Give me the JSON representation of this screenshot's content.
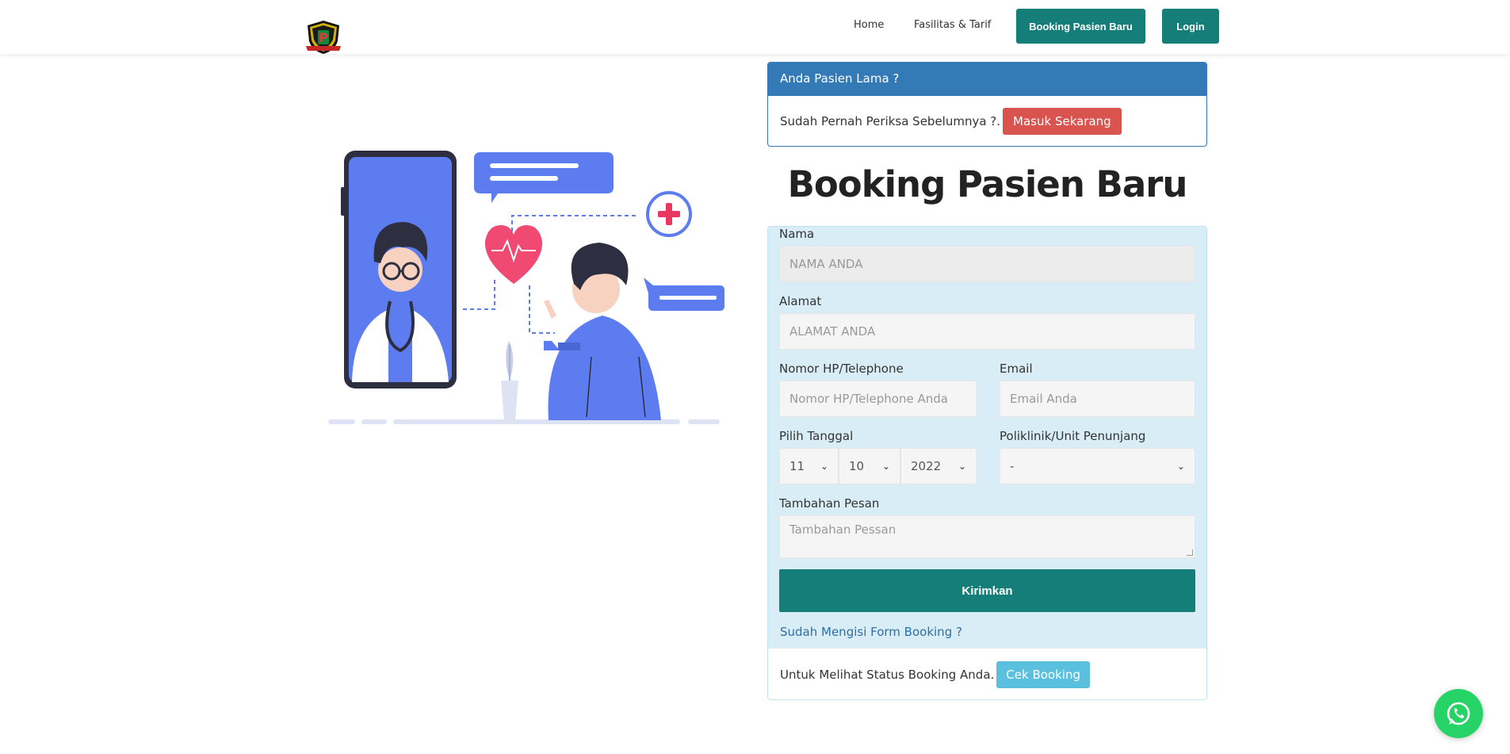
{
  "nav": {
    "home": "Home",
    "fasilitas": "Fasilitas & Tarif",
    "booking": "Booking Pasien Baru",
    "login": "Login"
  },
  "old_patient": {
    "heading": "Anda Pasien Lama ?",
    "text": "Sudah Pernah Periksa Sebelumnya ?.",
    "button": "Masuk Sekarang"
  },
  "page_title": "Booking Pasien Baru",
  "form": {
    "nama_label": "Nama",
    "nama_placeholder": "NAMA ANDA",
    "alamat_label": "Alamat",
    "alamat_placeholder": "ALAMAT ANDA",
    "hp_label": "Nomor HP/Telephone",
    "hp_placeholder": "Nomor HP/Telephone Anda",
    "email_label": "Email",
    "email_placeholder": "Email Anda",
    "tanggal_label": "Pilih Tanggal",
    "day": "11",
    "month": "10",
    "year": "2022",
    "poli_label": "Poliklinik/Unit Penunjang",
    "poli_value": "-",
    "pesan_label": "Tambahan Pesan",
    "pesan_placeholder": "Tambahan Pessan",
    "submit": "Kirimkan",
    "filled_question": "Sudah Mengisi Form Booking ?",
    "status_text": "Untuk Melihat Status Booking Anda.",
    "cek_button": "Cek Booking"
  },
  "colors": {
    "primary_teal": "#167e78",
    "panel_blue": "#337ab7",
    "danger_red": "#d9534f",
    "info_blue": "#5bc0de",
    "form_bg": "#d9edf7",
    "whatsapp_green": "#25d366"
  },
  "icons": {
    "logo": "hospital-shield-logo",
    "whatsapp": "whatsapp-icon",
    "chevron": "chevron-down-icon"
  }
}
